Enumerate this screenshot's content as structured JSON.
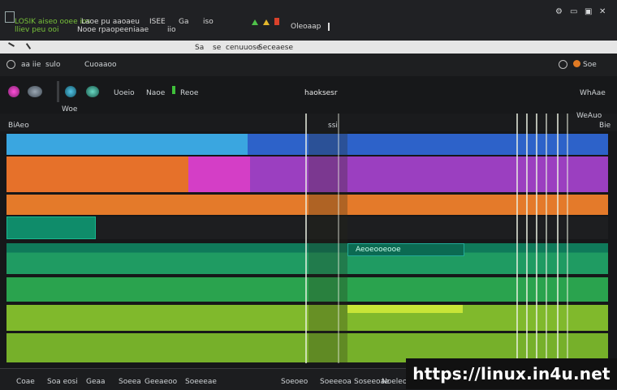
{
  "titlebar": {
    "left_title": "LOSIK aiseo ooee ios",
    "sub_title": "lliev peu ooi",
    "menu_a": "Laoe pu aaoaeu",
    "menu_a2": "Nooe rpaopeeniaae",
    "menu_b": "ISEE",
    "menu_b2": "iio",
    "menu_c": "Ga",
    "menu_d": "iso",
    "menu_e": "Oleoaap"
  },
  "mainmenu": {
    "item1": "Sa",
    "item2": "se",
    "item3": "cenuuose",
    "item4": "Seceaese"
  },
  "toolbar2": {
    "label1": "aa iie",
    "label2": "sulo",
    "label3": "Cuoaaoo",
    "right_label": "Soe"
  },
  "toolbar3": {
    "label1": "Uoeio",
    "label2": "Naoe",
    "label3": "Reoe",
    "center_title": "haoksesr",
    "right_label": "WhAae",
    "sub1": "Woe"
  },
  "ruler": {
    "left": "BiAeo",
    "center": "ssi",
    "right_top": "WeAuo",
    "right": "Bie"
  },
  "tracks": {
    "teal_label": "Aeoeooeooe"
  },
  "bottombar": {
    "b1": "Coae",
    "b2": "Soa eosi",
    "b3": "Geaa",
    "b4": "Soeea",
    "b5": "Geeaeoo",
    "b6": "Soeeeae",
    "b7": "Soeoeo",
    "b8": "Soeeeoa",
    "b9": "Soseeoae",
    "b10": "Noeleoes"
  },
  "watermark": "https://linux.in4u.net",
  "colors": {
    "blue": "#2f8fd8",
    "orange": "#e4742a",
    "magenta": "#c93fc0",
    "purple": "#9a44c4",
    "teal": "#0f8a6a",
    "green": "#239c5a",
    "lime": "#7db82a"
  }
}
